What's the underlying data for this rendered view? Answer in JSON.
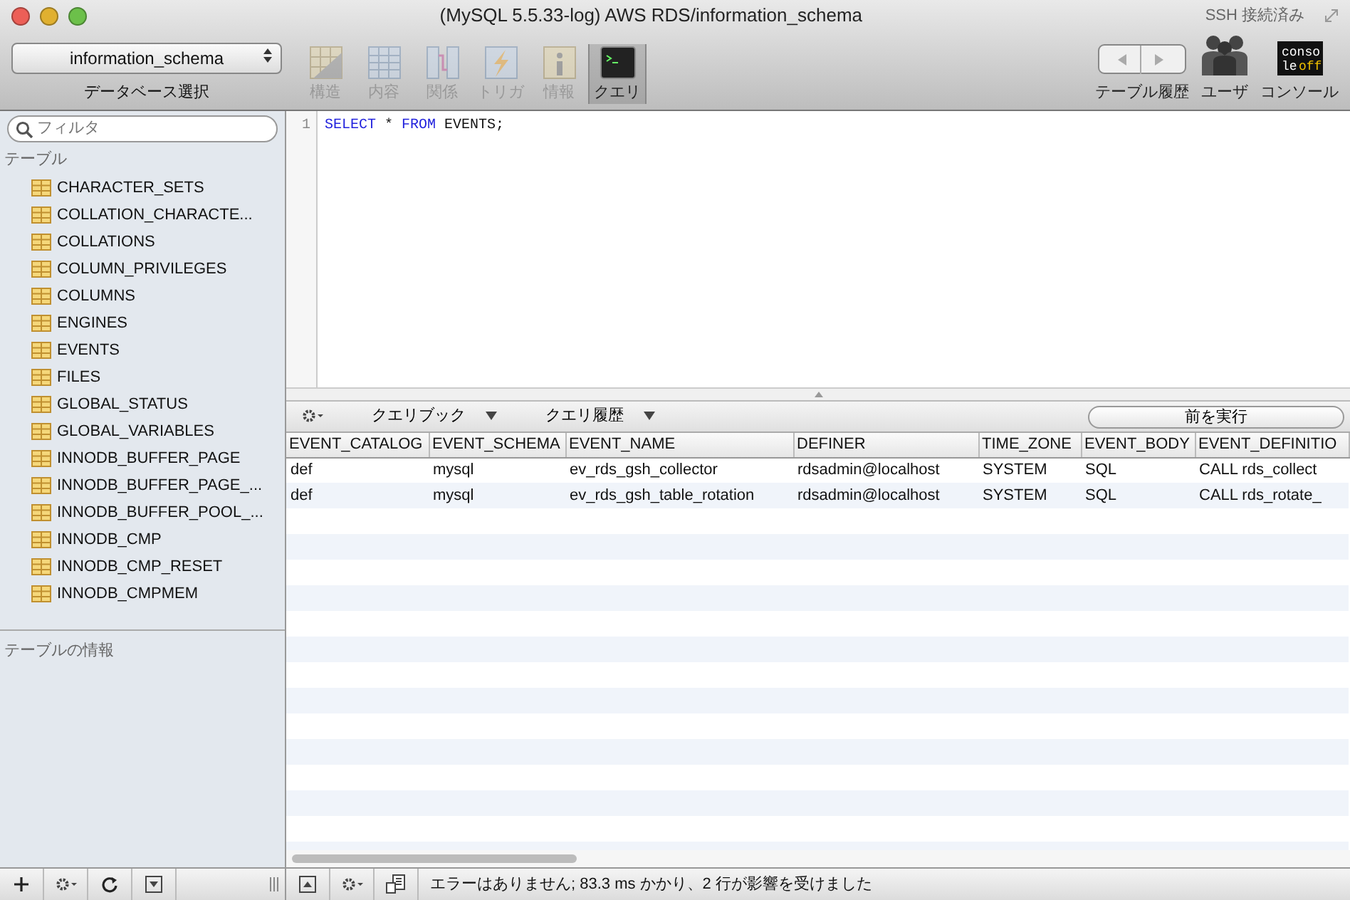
{
  "window": {
    "title": "(MySQL 5.5.33-log) AWS RDS/information_schema",
    "connection_status": "SSH 接続済み"
  },
  "toolbar": {
    "database": {
      "value": "information_schema",
      "label": "データベース選択"
    },
    "views": [
      {
        "label": "構造",
        "kind": "structure",
        "disabled": true,
        "selected": false
      },
      {
        "label": "内容",
        "kind": "content",
        "disabled": true,
        "selected": false
      },
      {
        "label": "関係",
        "kind": "relations",
        "disabled": true,
        "selected": false
      },
      {
        "label": "トリガ",
        "kind": "triggers",
        "disabled": true,
        "selected": false
      },
      {
        "label": "情報",
        "kind": "info",
        "disabled": true,
        "selected": false
      },
      {
        "label": "クエリ",
        "kind": "query",
        "disabled": false,
        "selected": true
      }
    ],
    "right": [
      {
        "label": "テーブル履歴",
        "kind": "history"
      },
      {
        "label": "ユーザ",
        "kind": "users"
      },
      {
        "label": "コンソール",
        "kind": "console",
        "badge": [
          "conso",
          "le",
          "off"
        ]
      }
    ]
  },
  "sidebar": {
    "filter_placeholder": "フィルタ",
    "section": "テーブル",
    "tables": [
      "CHARACTER_SETS",
      "COLLATION_CHARACTE...",
      "COLLATIONS",
      "COLUMN_PRIVILEGES",
      "COLUMNS",
      "ENGINES",
      "EVENTS",
      "FILES",
      "GLOBAL_STATUS",
      "GLOBAL_VARIABLES",
      "INNODB_BUFFER_PAGE",
      "INNODB_BUFFER_PAGE_...",
      "INNODB_BUFFER_POOL_...",
      "INNODB_CMP",
      "INNODB_CMP_RESET",
      "INNODB_CMPMEM"
    ],
    "info_title": "テーブルの情報"
  },
  "editor": {
    "line_number": "1",
    "tokens": [
      {
        "text": "SELECT",
        "kind": "keyword"
      },
      {
        "text": " * ",
        "kind": "plain"
      },
      {
        "text": "FROM",
        "kind": "keyword"
      },
      {
        "text": " EVENTS;",
        "kind": "plain"
      }
    ]
  },
  "query_bar": {
    "favorites": "クエリブック",
    "history": "クエリ履歴",
    "run_previous": "前を実行"
  },
  "results": {
    "columns": [
      "EVENT_CATALOG",
      "EVENT_SCHEMA",
      "EVENT_NAME",
      "DEFINER",
      "TIME_ZONE",
      "EVENT_BODY",
      "EVENT_DEFINITIO"
    ],
    "rows": [
      [
        "def",
        "mysql",
        "ev_rds_gsh_collector",
        "rdsadmin@localhost",
        "SYSTEM",
        "SQL",
        "CALL rds_collect"
      ],
      [
        "def",
        "mysql",
        "ev_rds_gsh_table_rotation",
        "rdsadmin@localhost",
        "SYSTEM",
        "SQL",
        "CALL rds_rotate_"
      ]
    ]
  },
  "status_bar": {
    "message": "エラーはありません; 83.3 ms かかり、2 行が影響を受けました"
  }
}
